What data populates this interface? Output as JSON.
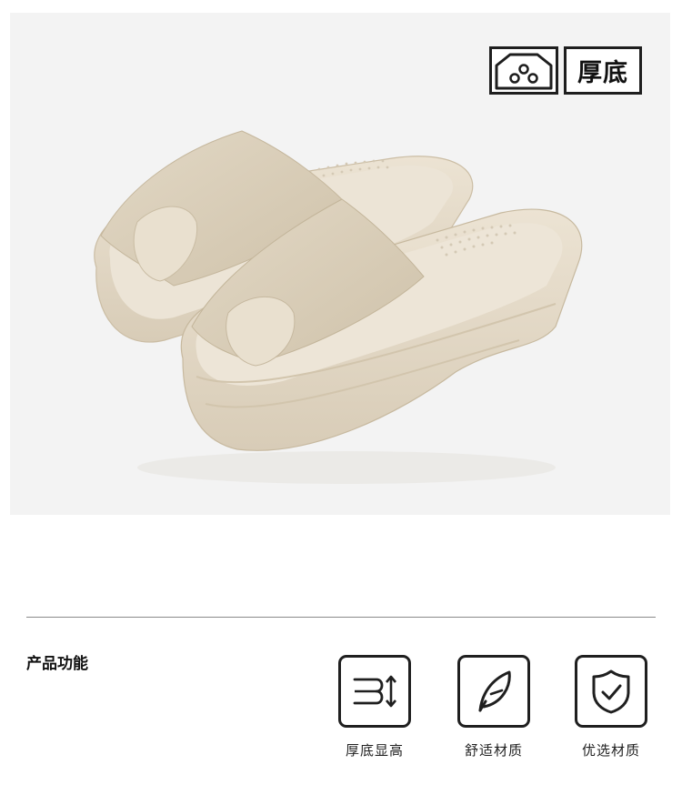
{
  "product_image": {
    "badge": {
      "icon": "shoe-box-icon",
      "text": "厚底"
    },
    "colors": {
      "background": "#f3f3f3",
      "slipper": "#e6dccb"
    }
  },
  "features": {
    "title": "产品功能",
    "items": [
      {
        "icon": "height-arrow-icon",
        "label": "厚底显高"
      },
      {
        "icon": "feather-icon",
        "label": "舒适材质"
      },
      {
        "icon": "shield-check-icon",
        "label": "优选材质"
      }
    ]
  }
}
